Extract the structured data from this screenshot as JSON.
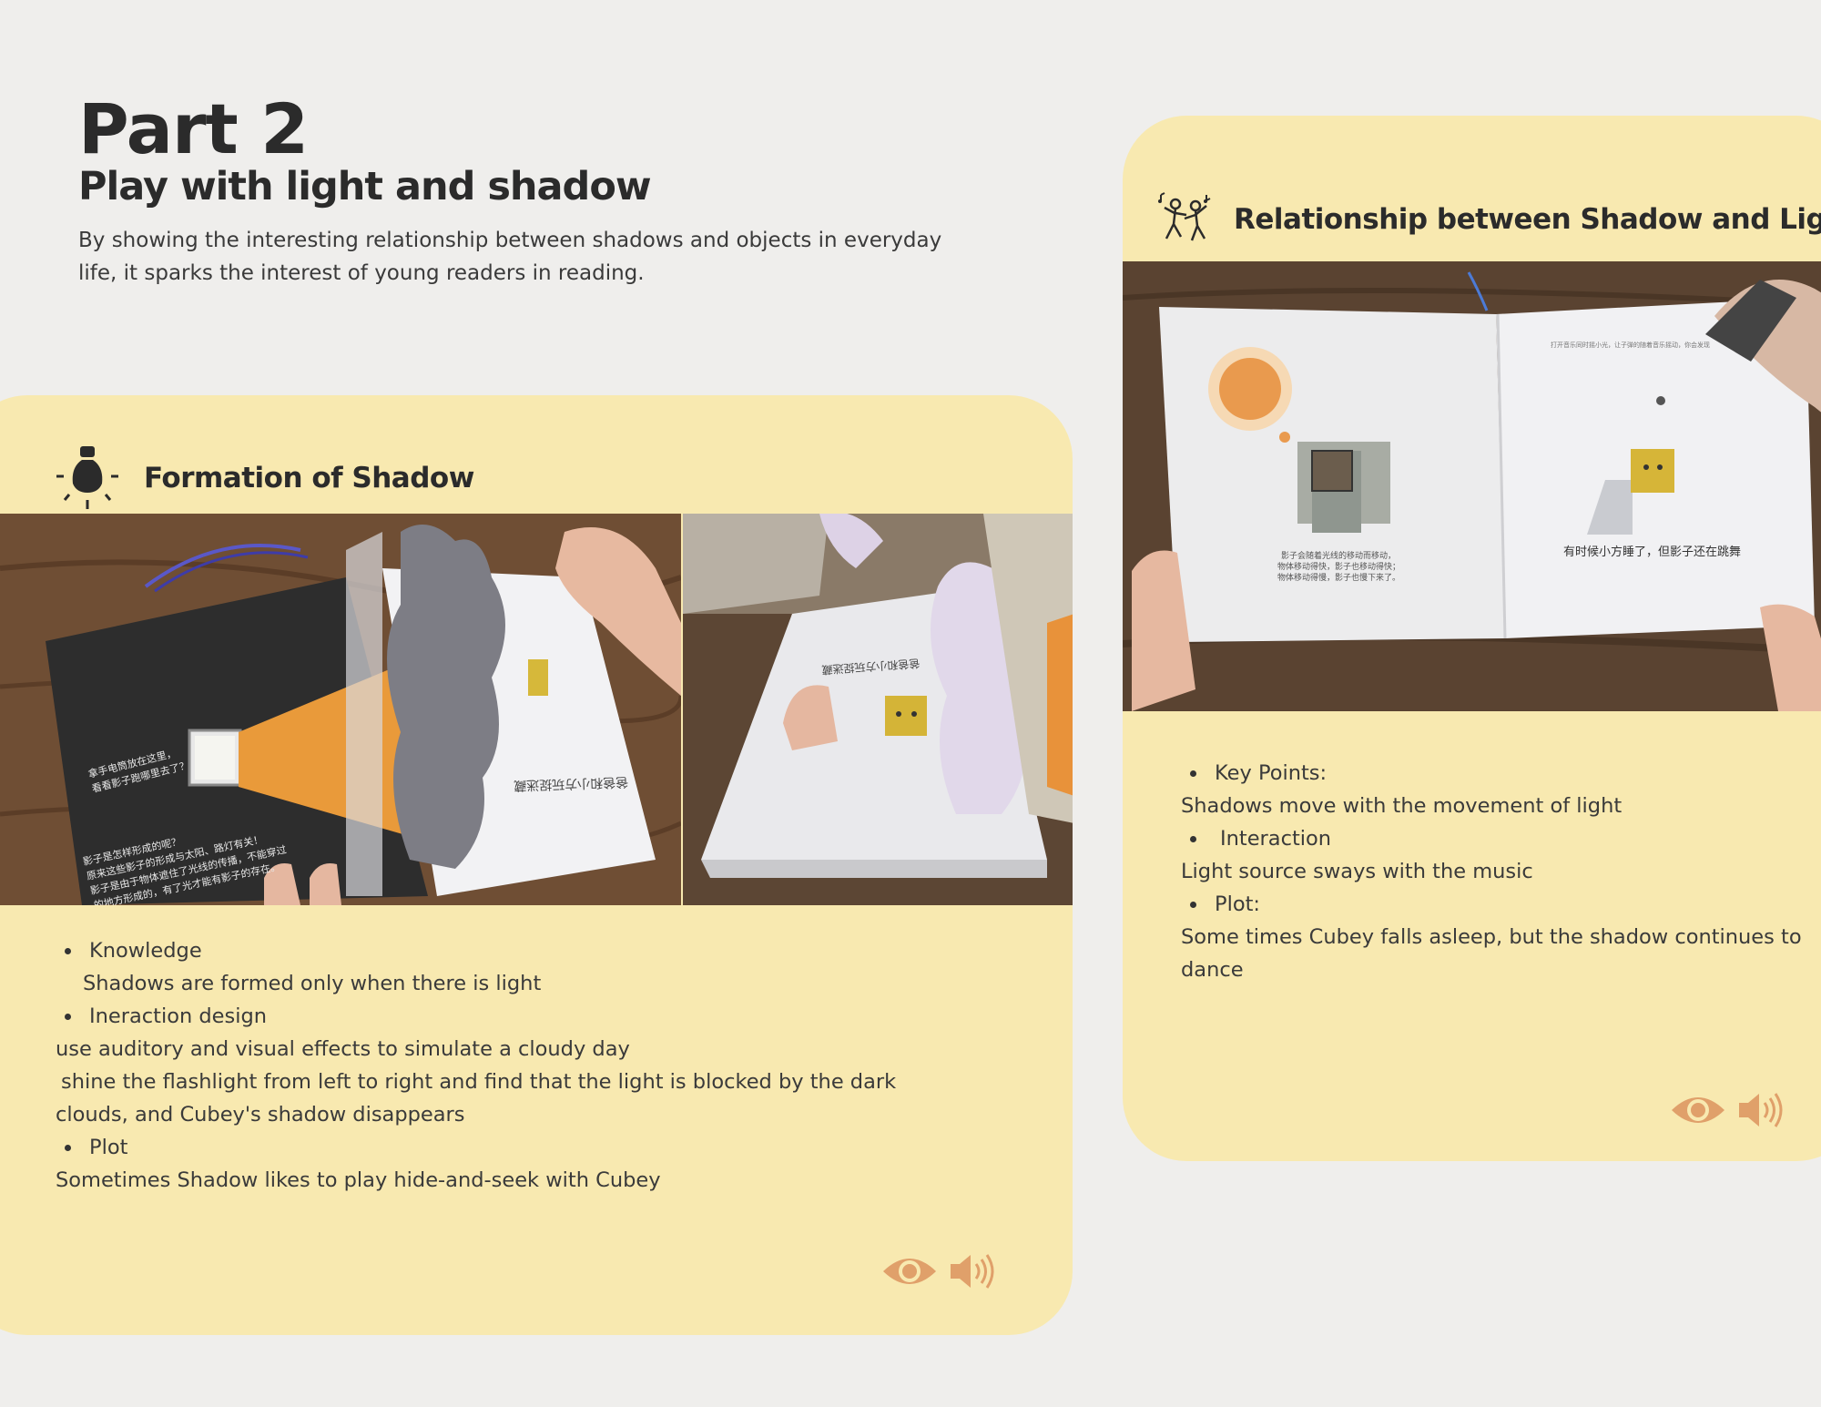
{
  "header": {
    "title": "Part 2",
    "subtitle": "Play with light and shadow",
    "intro_line1": "By showing the interesting relationship between shadows and objects in everyday",
    "intro_line2": "life, it sparks the interest of young readers in reading."
  },
  "left_card": {
    "icon": "lightbulb-icon",
    "heading": "Formation of Shadow",
    "photo1": {
      "caption_a1": "拿手电筒放在这里，",
      "caption_a2": "看看影子跑哪里去了？",
      "caption_b1": "影子是怎样形成的呢？",
      "caption_b2": "原来这些影子的形成与太阳、路灯有关！",
      "caption_b3": "影子是由于物体遮住了光线的传播，不能穿过",
      "caption_b4": "的地方形成的，有了光才能有影子的存在。",
      "caption_c": "爸爸和小方玩捉迷藏"
    },
    "photo2": {
      "caption": "爸爸和小方玩捉迷藏"
    },
    "lines": {
      "l1": "Knowledge",
      "l2": "Shadows are formed only when there is light",
      "l3": "Ineraction design",
      "l4": "use auditory and visual effects to simulate a cloudy day",
      "l5": "shine the flashlight from left to right and find that the light is blocked by the dark",
      "l6": "clouds, and Cubey's shadow disappears",
      "l7": "Plot",
      "l8": "Sometimes Shadow likes to play hide-and-seek with Cubey"
    },
    "icons": [
      "eye-icon",
      "speaker-icon"
    ]
  },
  "right_card": {
    "icon": "dancing-people-icon",
    "heading": "Relationship between Shadow and Light",
    "photo": {
      "left_caption1": "影子会随着光线的移动而移动，",
      "left_caption2": "物体移动得快，影子也移动得快；",
      "left_caption3": "物体移动得慢，影子也慢下来了。",
      "right_top": "打开音乐同时摇小光，让子弹的随着音乐摇动，你会发现",
      "right_caption": "有时候小方睡了，但影子还在跳舞"
    },
    "lines": {
      "l1": "Key Points:",
      "l2": "Shadows move with the movement of light",
      "l3": "Interaction",
      "l4": "Light source sways with the music",
      "l5": "Plot:",
      "l6": "Some times Cubey falls asleep, but the shadow continues to",
      "l7": "dance"
    },
    "icons": [
      "eye-icon",
      "speaker-icon"
    ]
  },
  "colors": {
    "background": "#efeeec",
    "card": "#f8e9b0",
    "accent": "#e0a06a",
    "text": "#2b2b2b"
  }
}
